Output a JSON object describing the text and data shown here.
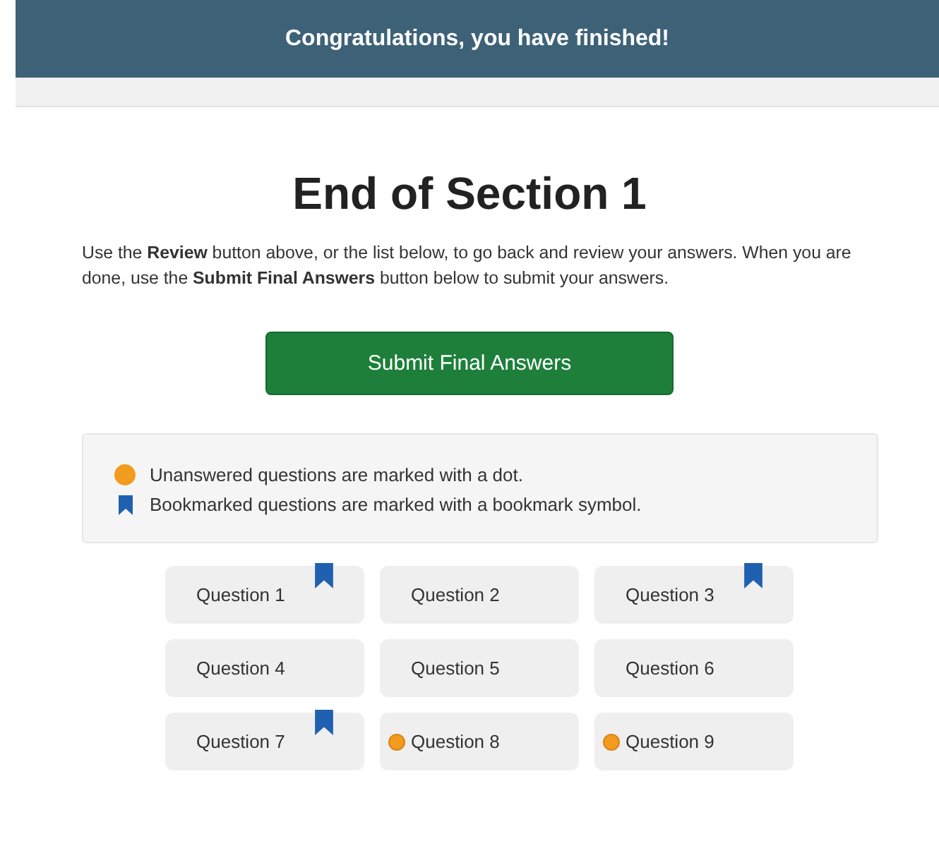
{
  "header": {
    "title": "Congratulations, you have finished!"
  },
  "section_title": "End of Section 1",
  "instructions": "Use the **Review** button above, or the list below, to go back and review your answers. When you are done, use the **Submit Final Answers** button below to submit your answers.",
  "submit_button": "Submit Final Answers",
  "legend": [
    {
      "kind": "dot",
      "text": "Unanswered questions are marked with a dot."
    },
    {
      "kind": "bookmark",
      "text": "Bookmarked questions are marked with a bookmark symbol."
    }
  ],
  "questions": [
    {
      "label": "Question 1",
      "bookmarked": true,
      "unanswered": false
    },
    {
      "label": "Question 2",
      "bookmarked": false,
      "unanswered": false
    },
    {
      "label": "Question 3",
      "bookmarked": true,
      "unanswered": false
    },
    {
      "label": "Question 4",
      "bookmarked": false,
      "unanswered": false
    },
    {
      "label": "Question 5",
      "bookmarked": false,
      "unanswered": false
    },
    {
      "label": "Question 6",
      "bookmarked": false,
      "unanswered": false
    },
    {
      "label": "Question 7",
      "bookmarked": true,
      "unanswered": false
    },
    {
      "label": "Question 8",
      "bookmarked": false,
      "unanswered": true
    },
    {
      "label": "Question 9",
      "bookmarked": false,
      "unanswered": true
    }
  ]
}
